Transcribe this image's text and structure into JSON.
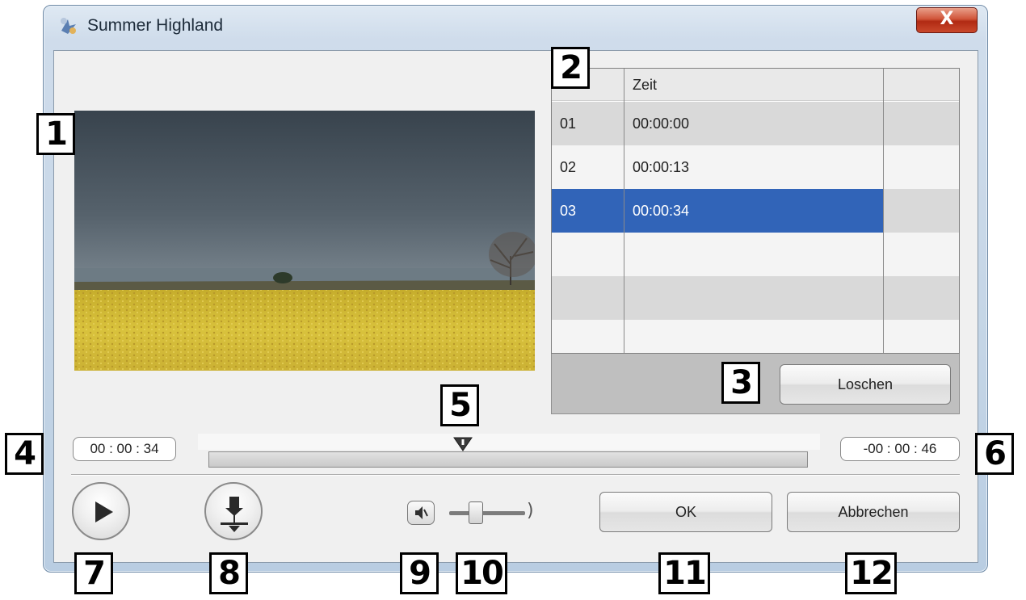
{
  "window": {
    "title": "Summer Highland",
    "close_glyph": "X",
    "icon": "app-icon"
  },
  "timeline_list": {
    "columns": [
      "",
      "Zeit",
      ""
    ],
    "rows": [
      {
        "index": "01",
        "time": "00:00:00",
        "selected": false
      },
      {
        "index": "02",
        "time": "00:00:13",
        "selected": false
      },
      {
        "index": "03",
        "time": "00:00:34",
        "selected": true
      },
      {
        "index": "",
        "time": "",
        "selected": false
      },
      {
        "index": "",
        "time": "",
        "selected": false
      },
      {
        "index": "",
        "time": "",
        "selected": false
      }
    ],
    "delete_label": "Loschen"
  },
  "playback": {
    "elapsed": "00 : 00 : 34",
    "remaining": "-00 : 00 : 46",
    "play_icon": "play-icon",
    "mark_icon": "chapter-mark-icon",
    "mute_icon": "speaker-mute-icon",
    "volume_icon": "volume-wave-icon"
  },
  "dialog_buttons": {
    "ok_label": "OK",
    "cancel_label": "Abbrechen"
  },
  "callouts": [
    "1",
    "2",
    "3",
    "4",
    "5",
    "6",
    "7",
    "8",
    "9",
    "10",
    "11",
    "12"
  ],
  "colors": {
    "selection": "#3164b8",
    "close_button": "#c9482b",
    "field_yellow": "#d8c23a",
    "sky": "#3f4a55"
  }
}
